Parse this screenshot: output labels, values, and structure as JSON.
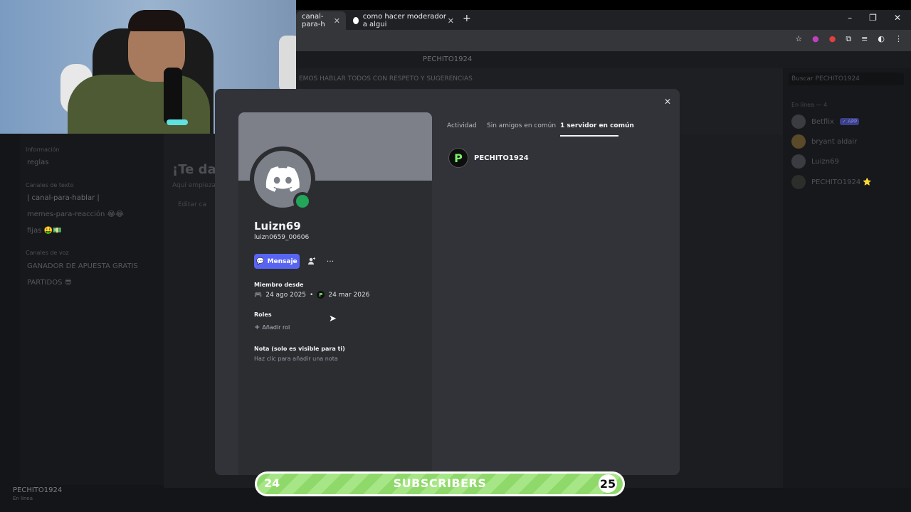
{
  "browser": {
    "tabs": [
      {
        "label": "canal-para-h",
        "close": "✕"
      },
      {
        "label": "como hacer moderador a algui",
        "close": "✕"
      }
    ],
    "new_tab": "+",
    "window_controls": [
      "–",
      "❐",
      "✕"
    ]
  },
  "discord_bg": {
    "server_name": "PECHITO1924",
    "channel_topic": "EMOS HABLAR TODOS CON RESPETO Y SUGERENCIAS",
    "categories": [
      "Información",
      "Canales de texto",
      "Canales de voz"
    ],
    "channels": [
      "reglas",
      "| canal-para-hablar |",
      "memes-para-reacción 😂😂",
      "fijas 🤑💵",
      "GANADOR DE APUESTA GRATIS",
      "PARTIDOS 😎"
    ],
    "welcome": "¡Te dar",
    "welcome_sub": "Aquí empieza",
    "edit": "Editar ca",
    "search_placeholder": "Buscar PECHITO1924",
    "members_header": "En línea — 4",
    "members": [
      {
        "name": "Betflix",
        "badge": "✓ APP"
      },
      {
        "name": "bryant aldair"
      },
      {
        "name": "Luizn69"
      },
      {
        "name": "PECHITO1924 ⭐"
      }
    ],
    "current_user": "PECHITO1924",
    "current_status": "En línea"
  },
  "profile": {
    "display_name": "Luizn69",
    "username": "luizn0659_00606",
    "message_button": "Mensaje",
    "member_since_label": "Miembro desde",
    "discord_date": "24 ago 2025",
    "server_date": "24 mar 2026",
    "roles_label": "Roles",
    "add_role": "Añadir rol",
    "note_label": "Nota (solo es visible para ti)",
    "note_placeholder": "Haz clic para añadir una nota",
    "close": "✕"
  },
  "profile_tabs": {
    "activity": "Actividad",
    "friends": "Sin amigos en común",
    "servers": "1 servidor en común"
  },
  "mutual_server": {
    "name": "PECHITO1924",
    "icon_letter": "P"
  },
  "subscribers": {
    "count": "24",
    "label": "SUBSCRIBERS",
    "goal": "25",
    "progress": 0.96
  },
  "colors": {
    "blurple": "#5865f2",
    "online": "#23a55a",
    "bar_green": "#8fd96b"
  }
}
